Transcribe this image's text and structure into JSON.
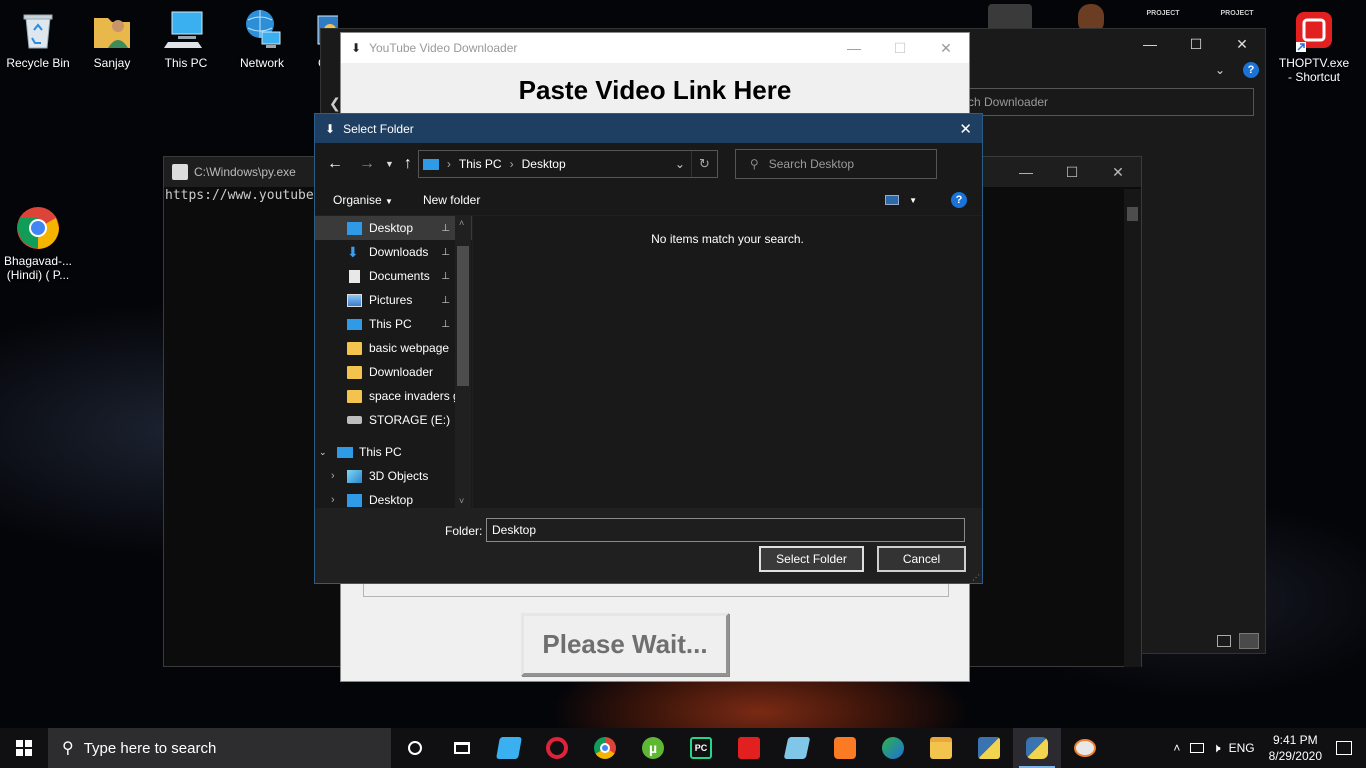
{
  "desktop": {
    "icons_left": [
      {
        "label": "Recycle Bin",
        "icon": "recycle-bin-icon"
      },
      {
        "label": "Sanjay",
        "icon": "user-folder-icon"
      },
      {
        "label": "This PC",
        "icon": "computer-icon"
      },
      {
        "label": "Network",
        "icon": "network-icon"
      },
      {
        "label": "C",
        "icon": "control-panel-icon"
      }
    ],
    "chrome_shortcut": {
      "line1": "Bhagavad-...",
      "line2": "(Hindi) ( P..."
    },
    "thoptv_shortcut": {
      "line1": "THOPTV.exe",
      "line2": "- Shortcut"
    }
  },
  "console_window": {
    "title": "C:\\Windows\\py.exe",
    "text": "https://www.youtube"
  },
  "explorer_window": {
    "search_placeholder": "rch Downloader"
  },
  "downloader_app": {
    "title": "YouTube Video Downloader",
    "heading": "Paste Video Link Here",
    "wait_button": "Please Wait..."
  },
  "select_folder_dialog": {
    "title": "Select Folder",
    "breadcrumb": [
      "This PC",
      "Desktop"
    ],
    "search_placeholder": "Search Desktop",
    "organise_label": "Organise",
    "new_folder_label": "New folder",
    "empty_message": "No items match your search.",
    "nav_quick": [
      {
        "label": "Desktop",
        "icon": "desktop-folder-icon",
        "pinned": true,
        "selected": true
      },
      {
        "label": "Downloads",
        "icon": "downloads-icon",
        "pinned": true
      },
      {
        "label": "Documents",
        "icon": "documents-icon",
        "pinned": true
      },
      {
        "label": "Pictures",
        "icon": "pictures-icon",
        "pinned": true
      },
      {
        "label": "This PC",
        "icon": "computer-icon",
        "pinned": true
      },
      {
        "label": "basic webpage",
        "icon": "folder-icon"
      },
      {
        "label": "Downloader",
        "icon": "folder-icon"
      },
      {
        "label": "space invaders g",
        "icon": "folder-icon"
      },
      {
        "label": "STORAGE (E:)",
        "icon": "drive-icon"
      }
    ],
    "nav_thispc": {
      "label": "This PC",
      "children": [
        {
          "label": "3D Objects",
          "icon": "3d-objects-icon"
        },
        {
          "label": "Desktop",
          "icon": "desktop-folder-icon"
        }
      ]
    },
    "folder_label": "Folder:",
    "folder_value": "Desktop",
    "select_button": "Select Folder",
    "cancel_button": "Cancel"
  },
  "taskbar": {
    "search_placeholder": "Type here to search",
    "lang": "ENG",
    "time": "9:41 PM",
    "date": "8/29/2020"
  },
  "colors": {
    "dialog_title": "#1f3f62",
    "accent": "#0078d7",
    "folder": "#f2c44e"
  }
}
